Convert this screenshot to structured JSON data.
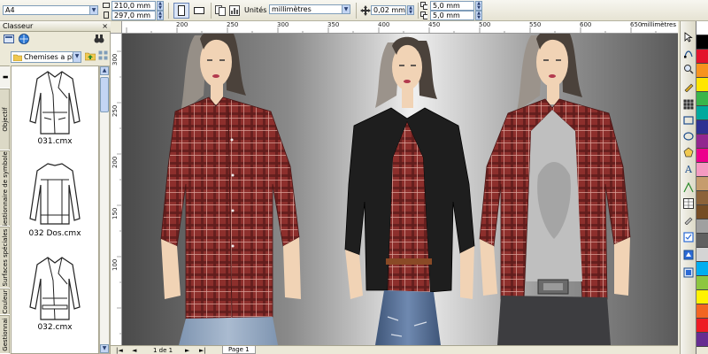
{
  "propbar": {
    "paper_size": "A4",
    "width_value": "210,0 mm",
    "height_value": "297,0 mm",
    "units_label": "Unités :",
    "units_value": "millimètres",
    "nudge_value": "0,02 mm",
    "dup_x_value": "5,0 mm",
    "dup_y_value": "5,0 mm"
  },
  "docker": {
    "title": "Classeur",
    "close_glyph": "×",
    "folder_value": "Chemises a  plat",
    "tabs": [
      "Objectif",
      "Gestionnaire de symboles",
      "Surfaces spéciales",
      "Couleur",
      "Gestionnai"
    ],
    "thumbnails": [
      "031.cmx",
      "032 Dos.cmx",
      "032.cmx"
    ]
  },
  "ruler": {
    "unit": "millimètres",
    "h_ticks": [
      "200",
      "250",
      "300",
      "350",
      "400",
      "450",
      "500",
      "550",
      "600",
      "650"
    ],
    "v_ticks": [
      "300",
      "250",
      "200",
      "150",
      "100"
    ]
  },
  "statusbar": {
    "page_counter": "1 de 1",
    "page_tab": "Page 1"
  },
  "colors": {
    "plaid_red": "#8d2f2c",
    "plaid_dark": "#5e1d1c",
    "jacket_black": "#1e1e1e",
    "jeans_blue": "#5e78a0",
    "light_jeans": "#8ea4c0",
    "dark_jeans": "#3d3d40",
    "tshirt_grey": "#bfbfbf",
    "skin": "#f1d3b5",
    "hair_dark": "#4b423b",
    "hair_light": "#9b938b"
  },
  "palette": [
    "#ffffff",
    "#000000",
    "#e3122b",
    "#f7931e",
    "#ffe600",
    "#39b54a",
    "#00a99d",
    "#2e3192",
    "#92278f",
    "#ec008c",
    "#f49ac1",
    "#c69c6d",
    "#8c6239",
    "#754c24",
    "#a0a0a0",
    "#606060",
    "#d4d4d4",
    "#00aeef",
    "#8dc63f",
    "#fff200",
    "#f26522",
    "#ed1c24",
    "#662d91"
  ]
}
